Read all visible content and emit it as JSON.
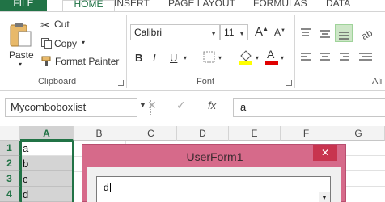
{
  "tabs": [
    "FILE",
    "HOME",
    "INSERT",
    "PAGE LAYOUT",
    "FORMULAS",
    "DATA"
  ],
  "clipboard": {
    "paste": "Paste",
    "cut": "Cut",
    "copy": "Copy",
    "format_painter": "Format Painter",
    "label": "Clipboard"
  },
  "font": {
    "name": "Calibri",
    "size": "11",
    "bold": "B",
    "italic": "I",
    "underline": "U",
    "color_letter": "A",
    "grow": "A",
    "shrink": "A",
    "label": "Font"
  },
  "alignment": {
    "label": "Ali"
  },
  "formula_bar": {
    "name_box": "Mycomboboxlist",
    "cancel": "✕",
    "enter": "✓",
    "fx": "fx",
    "value": "a"
  },
  "columns": [
    "A",
    "B",
    "C",
    "D",
    "E",
    "F",
    "G"
  ],
  "rows": [
    {
      "num": "1",
      "a": "a"
    },
    {
      "num": "2",
      "a": "b"
    },
    {
      "num": "3",
      "a": "c"
    },
    {
      "num": "4",
      "a": "d"
    }
  ],
  "userform": {
    "title": "UserForm1",
    "close": "✕",
    "combo_value": "d"
  },
  "colors": {
    "excel_green": "#217346",
    "form_frame": "#d66a8a",
    "close_red": "#c8344f"
  }
}
